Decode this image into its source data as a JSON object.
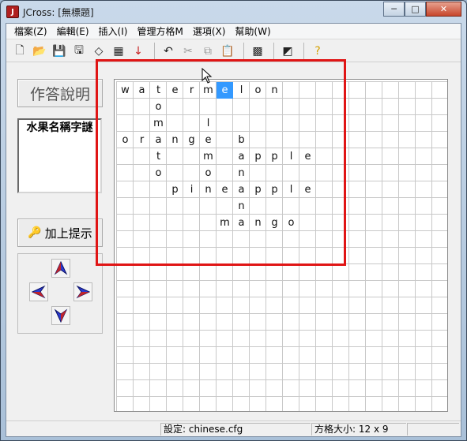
{
  "window": {
    "title": "JCross: [無標題]",
    "app_icon_glyph": "J",
    "minimize": "─",
    "maximize": "□",
    "close": "✕"
  },
  "menu": [
    "檔案(Z)",
    "編輯(E)",
    "插入(I)",
    "管理方格M",
    "選項(X)",
    "幫助(W)"
  ],
  "toolbar": [
    {
      "icon": "new-file-icon",
      "glyph": "🗋",
      "disabled": false
    },
    {
      "icon": "open-folder-icon",
      "glyph": "📂",
      "disabled": false
    },
    {
      "icon": "save-icon",
      "glyph": "💾",
      "disabled": false
    },
    {
      "icon": "save-as-icon",
      "glyph": "🖫",
      "disabled": false
    },
    {
      "icon": "eraser-icon",
      "glyph": "◇",
      "disabled": false
    },
    {
      "icon": "grid-settings-icon",
      "glyph": "▦",
      "disabled": false
    },
    {
      "icon": "down-arrow-icon",
      "glyph": "↓",
      "disabled": false
    },
    {
      "sep": true
    },
    {
      "icon": "undo-icon",
      "glyph": "↶",
      "disabled": false
    },
    {
      "icon": "cut-icon",
      "glyph": "✂",
      "disabled": true
    },
    {
      "icon": "copy-icon",
      "glyph": "⧉",
      "disabled": true
    },
    {
      "icon": "paste-icon",
      "glyph": "📋",
      "disabled": false
    },
    {
      "sep": true
    },
    {
      "icon": "build-grid-icon",
      "glyph": "▩",
      "disabled": false
    },
    {
      "sep": true
    },
    {
      "icon": "export-web-icon",
      "glyph": "◩",
      "disabled": false
    },
    {
      "sep": true
    },
    {
      "icon": "help-icon",
      "glyph": "?",
      "disabled": false
    }
  ],
  "left_panel": {
    "answer_button": "作答說明",
    "clue_title": "水果名稱字謎",
    "hint_button": "加上提示",
    "key_glyph": "🔑"
  },
  "grid": {
    "cols": 20,
    "rows": 20,
    "cells": [
      {
        "r": 0,
        "c": 0,
        "ch": "w"
      },
      {
        "r": 0,
        "c": 1,
        "ch": "a"
      },
      {
        "r": 0,
        "c": 2,
        "ch": "t"
      },
      {
        "r": 0,
        "c": 3,
        "ch": "e"
      },
      {
        "r": 0,
        "c": 4,
        "ch": "r"
      },
      {
        "r": 0,
        "c": 5,
        "ch": "m"
      },
      {
        "r": 0,
        "c": 6,
        "ch": "e",
        "sel": true
      },
      {
        "r": 0,
        "c": 7,
        "ch": "l"
      },
      {
        "r": 0,
        "c": 8,
        "ch": "o"
      },
      {
        "r": 0,
        "c": 9,
        "ch": "n"
      },
      {
        "r": 1,
        "c": 2,
        "ch": "o"
      },
      {
        "r": 2,
        "c": 2,
        "ch": "m"
      },
      {
        "r": 2,
        "c": 5,
        "ch": "l"
      },
      {
        "r": 3,
        "c": 0,
        "ch": "o"
      },
      {
        "r": 3,
        "c": 1,
        "ch": "r"
      },
      {
        "r": 3,
        "c": 2,
        "ch": "a"
      },
      {
        "r": 3,
        "c": 3,
        "ch": "n"
      },
      {
        "r": 3,
        "c": 4,
        "ch": "g"
      },
      {
        "r": 3,
        "c": 5,
        "ch": "e"
      },
      {
        "r": 3,
        "c": 7,
        "ch": "b"
      },
      {
        "r": 4,
        "c": 2,
        "ch": "t"
      },
      {
        "r": 4,
        "c": 5,
        "ch": "m"
      },
      {
        "r": 4,
        "c": 7,
        "ch": "a"
      },
      {
        "r": 4,
        "c": 8,
        "ch": "p"
      },
      {
        "r": 4,
        "c": 9,
        "ch": "p"
      },
      {
        "r": 4,
        "c": 10,
        "ch": "l"
      },
      {
        "r": 4,
        "c": 11,
        "ch": "e"
      },
      {
        "r": 5,
        "c": 2,
        "ch": "o"
      },
      {
        "r": 5,
        "c": 5,
        "ch": "o"
      },
      {
        "r": 5,
        "c": 7,
        "ch": "n"
      },
      {
        "r": 6,
        "c": 3,
        "ch": "p"
      },
      {
        "r": 6,
        "c": 4,
        "ch": "i"
      },
      {
        "r": 6,
        "c": 5,
        "ch": "n"
      },
      {
        "r": 6,
        "c": 6,
        "ch": "e"
      },
      {
        "r": 6,
        "c": 7,
        "ch": "a"
      },
      {
        "r": 6,
        "c": 8,
        "ch": "p"
      },
      {
        "r": 6,
        "c": 9,
        "ch": "p"
      },
      {
        "r": 6,
        "c": 10,
        "ch": "l"
      },
      {
        "r": 6,
        "c": 11,
        "ch": "e"
      },
      {
        "r": 7,
        "c": 7,
        "ch": "n"
      },
      {
        "r": 8,
        "c": 6,
        "ch": "m"
      },
      {
        "r": 8,
        "c": 7,
        "ch": "a"
      },
      {
        "r": 8,
        "c": 8,
        "ch": "n"
      },
      {
        "r": 8,
        "c": 9,
        "ch": "g"
      },
      {
        "r": 8,
        "c": 10,
        "ch": "o"
      }
    ]
  },
  "status": {
    "config": "設定: chinese.cfg",
    "grid_size": "方格大小: 12 x 9"
  },
  "colors": {
    "highlight": "#e01515",
    "selected_cell": "#3399ff"
  }
}
